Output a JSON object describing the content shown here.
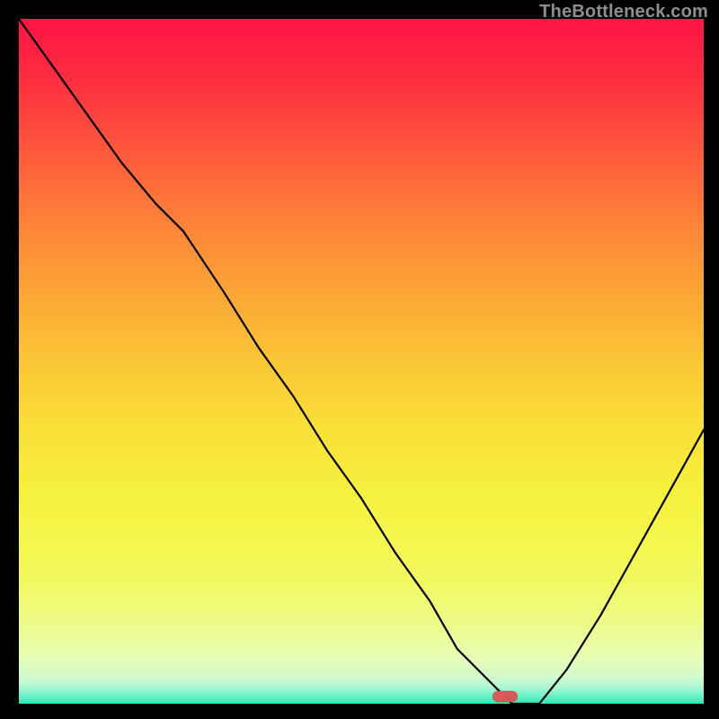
{
  "watermark": "TheBottleneck.com",
  "chart_data": {
    "type": "line",
    "title": "",
    "xlabel": "",
    "ylabel": "",
    "xlim": [
      0,
      100
    ],
    "ylim": [
      0,
      100
    ],
    "grid": false,
    "legend": false,
    "series": [
      {
        "name": "bottleneck-curve",
        "x": [
          0,
          5,
          10,
          15,
          20,
          24,
          30,
          35,
          40,
          45,
          50,
          55,
          60,
          64,
          70,
          72,
          76,
          80,
          85,
          90,
          95,
          100
        ],
        "y": [
          100,
          93,
          86,
          79,
          73,
          69,
          60,
          52,
          45,
          37,
          30,
          22,
          15,
          8,
          2,
          0,
          0,
          5,
          13,
          22,
          31,
          40
        ]
      }
    ],
    "marker": {
      "name": "optimal-point",
      "x": 71,
      "y": 0,
      "shape": "pill",
      "color": "#d65a5a"
    },
    "background_gradient": {
      "top": "#fe1445",
      "mid": "#fbc636",
      "bottom": "#2be7b0"
    }
  }
}
